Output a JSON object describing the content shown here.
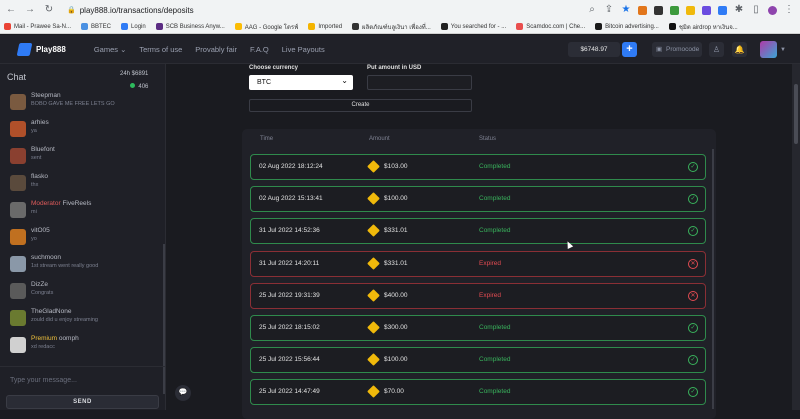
{
  "browser": {
    "url": "play888.io/transactions/deposits",
    "bookmarks": [
      {
        "label": "Mail - Prawee Sa-N...",
        "color": "#ea4335"
      },
      {
        "label": "BBTEC",
        "color": "#4a90e2"
      },
      {
        "label": "Login",
        "color": "#2f7bf5"
      },
      {
        "label": "SCB Business Anyw...",
        "color": "#5b2c83"
      },
      {
        "label": "AAG - Google โดรฟ์",
        "color": "#fbbc04"
      },
      {
        "label": "Imported",
        "color": "#f4b400"
      },
      {
        "label": "ผลิตภัณฑ์บลูเงินา เพื่องที่...",
        "color": "#333333"
      },
      {
        "label": "You searched for - ...",
        "color": "#222222"
      },
      {
        "label": "Scamdoc.com | Che...",
        "color": "#e94e4e"
      },
      {
        "label": "Bitcoin advertising...",
        "color": "#1a1a1a"
      },
      {
        "label": "ชุมิต airdrop หาเงินจ...",
        "color": "#111111"
      }
    ]
  },
  "header": {
    "logo": "Play888",
    "nav": [
      "Games ⌄",
      "Terms of use",
      "Provably fair",
      "F.A.Q",
      "Live Payouts"
    ],
    "balance": "$6748.97",
    "plus": "+",
    "promocode": "Promocode"
  },
  "chat": {
    "title": "Chat",
    "stat_24h": "24h $6891",
    "online": "406",
    "messages": [
      {
        "name": "Steepman",
        "role": "",
        "text": "BOBO GAVE ME FREE LETS GO",
        "color": "#7a5a40"
      },
      {
        "name": "arhies",
        "role": "",
        "text": "ya",
        "color": "#b0502a"
      },
      {
        "name": "Bluefont",
        "role": "",
        "text": "sent",
        "color": "#8a4030"
      },
      {
        "name": "flasko",
        "role": "",
        "text": "thx",
        "color": "#5a4a3c"
      },
      {
        "name": "FiveReels",
        "role": "Moderator",
        "text": "mi",
        "color": "#6a6a6a"
      },
      {
        "name": "vitO05",
        "role": "",
        "text": "yo",
        "color": "#c07020"
      },
      {
        "name": "suchmoon",
        "role": "",
        "text": "1st stream went really good",
        "color": "#8a98a8"
      },
      {
        "name": "DizZe",
        "role": "",
        "text": "Congrats",
        "color": "#5a5a5a"
      },
      {
        "name": "TheGladNone",
        "role": "",
        "text": "zould did u enjoy streaming",
        "color": "#6a7a30"
      },
      {
        "name": "oomph",
        "role": "Premium",
        "text": "xd redacc",
        "color": "#d0d0d0"
      }
    ],
    "input_placeholder": "Type your message...",
    "send": "SEND"
  },
  "deposit_form": {
    "currency_label": "Choose currency",
    "currency_value": "BTC",
    "amount_label": "Put amount in USD",
    "create": "Create"
  },
  "transactions": {
    "columns": [
      "Time",
      "Amount",
      "Status"
    ],
    "rows": [
      {
        "time": "02 Aug 2022 18:12:24",
        "amount": "$103.00",
        "status": "Completed",
        "ok": true
      },
      {
        "time": "02 Aug 2022 15:13:41",
        "amount": "$100.00",
        "status": "Completed",
        "ok": true
      },
      {
        "time": "31 Jul 2022 14:52:36",
        "amount": "$331.01",
        "status": "Completed",
        "ok": true
      },
      {
        "time": "31 Jul 2022 14:20:11",
        "amount": "$331.01",
        "status": "Expired",
        "ok": false
      },
      {
        "time": "25 Jul 2022 19:31:39",
        "amount": "$400.00",
        "status": "Expired",
        "ok": false
      },
      {
        "time": "25 Jul 2022 18:15:02",
        "amount": "$300.00",
        "status": "Completed",
        "ok": true
      },
      {
        "time": "25 Jul 2022 15:56:44",
        "amount": "$100.00",
        "status": "Completed",
        "ok": true
      },
      {
        "time": "25 Jul 2022 14:47:49",
        "amount": "$70.00",
        "status": "Completed",
        "ok": true
      }
    ]
  }
}
